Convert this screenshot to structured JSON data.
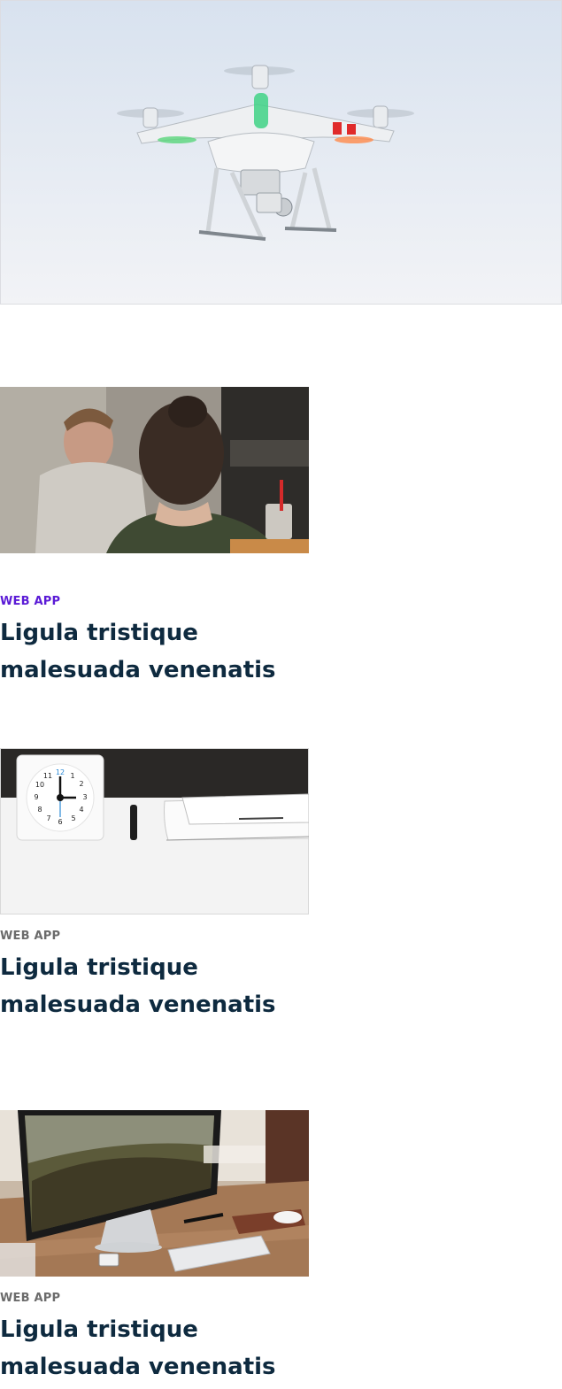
{
  "colors": {
    "title": "#0e2a3f",
    "category_active": "#5a1ad6",
    "category_default": "#6b6b6b"
  },
  "hero": {
    "icon": "drone-photo"
  },
  "cards": [
    {
      "image": "people-meeting-photo",
      "category": "WEB APP",
      "title": "Ligula tristique malesuada venenatis",
      "active": true
    },
    {
      "image": "desk-clock-photo",
      "category": "WEB APP",
      "title": "Ligula tristique malesuada venenatis",
      "active": false
    },
    {
      "image": "desktop-monitor-photo",
      "category": "WEB APP",
      "title": "Ligula tristique malesuada venenatis",
      "active": false
    }
  ]
}
